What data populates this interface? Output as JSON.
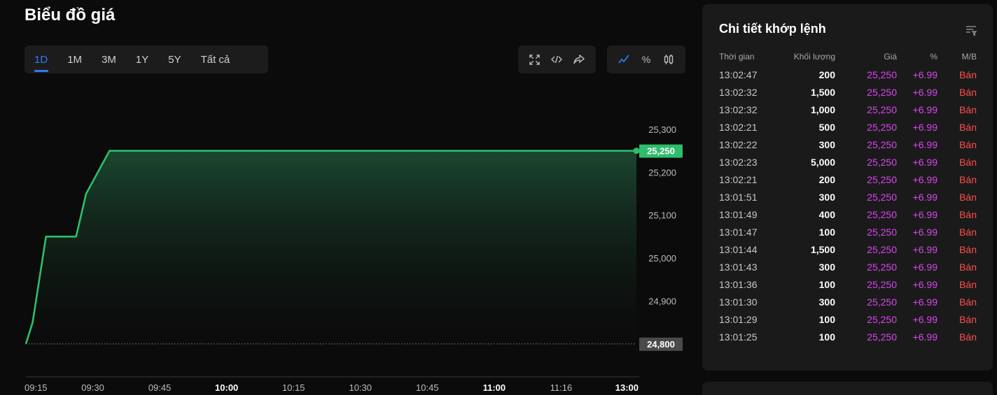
{
  "page": {
    "title": "Biểu đồ giá"
  },
  "range_tabs": [
    {
      "label": "1D",
      "active": true
    },
    {
      "label": "1M",
      "active": false
    },
    {
      "label": "3M",
      "active": false
    },
    {
      "label": "1Y",
      "active": false
    },
    {
      "label": "5Y",
      "active": false
    },
    {
      "label": "Tất cả",
      "active": false
    }
  ],
  "toolbar": {
    "tools": [
      "expand-icon",
      "embed-code-icon",
      "share-icon"
    ],
    "chart_modes": [
      "line-chart-icon",
      "percent-icon",
      "candlestick-icon"
    ],
    "percent_glyph": "%",
    "active_mode": "line-chart-icon"
  },
  "colors": {
    "accent": "#2f7bf5",
    "line": "#2ebd6b",
    "price": "#d946ef",
    "sell": "#ff4d4f",
    "ref_badge": "#4a4a4a"
  },
  "chart_data": {
    "type": "area",
    "x_labels": [
      {
        "label": "09:15",
        "bold": false
      },
      {
        "label": "09:30",
        "bold": false
      },
      {
        "label": "09:45",
        "bold": false
      },
      {
        "label": "10:00",
        "bold": true
      },
      {
        "label": "10:15",
        "bold": false
      },
      {
        "label": "10:30",
        "bold": false
      },
      {
        "label": "10:45",
        "bold": false
      },
      {
        "label": "11:00",
        "bold": true
      },
      {
        "label": "11:16",
        "bold": false
      },
      {
        "label": "13:00",
        "bold": true
      }
    ],
    "points": [
      {
        "t": 0.0,
        "v": 24800
      },
      {
        "t": 0.1,
        "v": 24850
      },
      {
        "t": 0.3,
        "v": 25050
      },
      {
        "t": 0.75,
        "v": 25050
      },
      {
        "t": 0.9,
        "v": 25150
      },
      {
        "t": 1.25,
        "v": 25250
      },
      {
        "t": 9.0,
        "v": 25250
      }
    ],
    "y_ticks": [
      24900,
      25000,
      25100,
      25200,
      25300
    ],
    "ylim": [
      24790,
      25300
    ],
    "last_price": 25250,
    "last_price_label": "25,250",
    "reference_price": 24800,
    "reference_price_label": "24,800",
    "grid": false
  },
  "trades_panel": {
    "title": "Chi tiết khớp lệnh",
    "columns": [
      "Thời gian",
      "Khối lượng",
      "Giá",
      "%",
      "M/B"
    ],
    "rows": [
      {
        "time": "13:02:47",
        "volume": "200",
        "price": "25,250",
        "change": "+6.99",
        "side": "Bán"
      },
      {
        "time": "13:02:32",
        "volume": "1,500",
        "price": "25,250",
        "change": "+6.99",
        "side": "Bán"
      },
      {
        "time": "13:02:32",
        "volume": "1,000",
        "price": "25,250",
        "change": "+6.99",
        "side": "Bán"
      },
      {
        "time": "13:02:21",
        "volume": "500",
        "price": "25,250",
        "change": "+6.99",
        "side": "Bán"
      },
      {
        "time": "13:02:22",
        "volume": "300",
        "price": "25,250",
        "change": "+6.99",
        "side": "Bán"
      },
      {
        "time": "13:02:23",
        "volume": "5,000",
        "price": "25,250",
        "change": "+6.99",
        "side": "Bán"
      },
      {
        "time": "13:02:21",
        "volume": "200",
        "price": "25,250",
        "change": "+6.99",
        "side": "Bán"
      },
      {
        "time": "13:01:51",
        "volume": "300",
        "price": "25,250",
        "change": "+6.99",
        "side": "Bán"
      },
      {
        "time": "13:01:49",
        "volume": "400",
        "price": "25,250",
        "change": "+6.99",
        "side": "Bán"
      },
      {
        "time": "13:01:47",
        "volume": "100",
        "price": "25,250",
        "change": "+6.99",
        "side": "Bán"
      },
      {
        "time": "13:01:44",
        "volume": "1,500",
        "price": "25,250",
        "change": "+6.99",
        "side": "Bán"
      },
      {
        "time": "13:01:43",
        "volume": "300",
        "price": "25,250",
        "change": "+6.99",
        "side": "Bán"
      },
      {
        "time": "13:01:36",
        "volume": "100",
        "price": "25,250",
        "change": "+6.99",
        "side": "Bán"
      },
      {
        "time": "13:01:30",
        "volume": "300",
        "price": "25,250",
        "change": "+6.99",
        "side": "Bán"
      },
      {
        "time": "13:01:29",
        "volume": "100",
        "price": "25,250",
        "change": "+6.99",
        "side": "Bán"
      },
      {
        "time": "13:01:25",
        "volume": "100",
        "price": "25,250",
        "change": "+6.99",
        "side": "Bán"
      }
    ]
  }
}
